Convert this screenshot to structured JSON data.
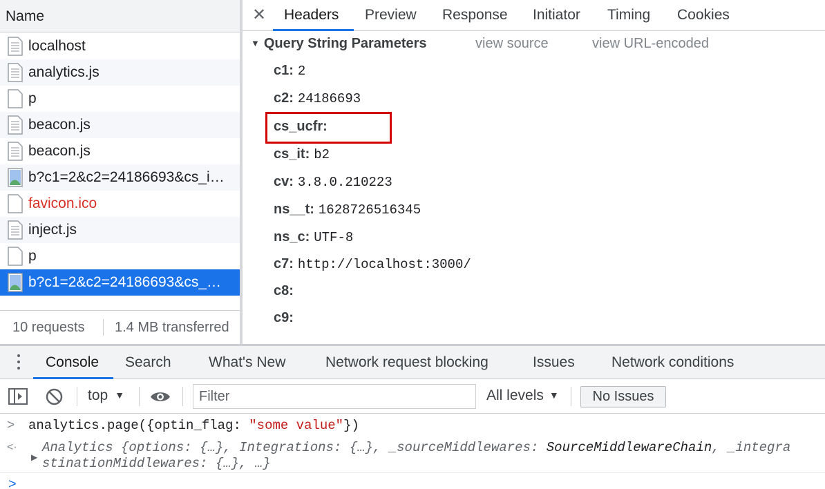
{
  "request_list": {
    "header": "Name",
    "items": [
      {
        "name": "localhost",
        "icon": "document-icon"
      },
      {
        "name": "analytics.js",
        "icon": "script-icon"
      },
      {
        "name": "p",
        "icon": "blank-file-icon"
      },
      {
        "name": "beacon.js",
        "icon": "script-icon"
      },
      {
        "name": "beacon.js",
        "icon": "script-icon"
      },
      {
        "name": "b?c1=2&c2=24186693&cs_i…",
        "icon": "image-icon"
      },
      {
        "name": "favicon.ico",
        "icon": "blank-file-icon",
        "status": "error"
      },
      {
        "name": "inject.js",
        "icon": "script-icon"
      },
      {
        "name": "p",
        "icon": "blank-file-icon"
      },
      {
        "name": "b?c1=2&c2=24186693&cs_…",
        "icon": "image-icon",
        "selected": true
      }
    ],
    "status": {
      "requests": "10 requests",
      "transferred": "1.4 MB transferred"
    }
  },
  "detail": {
    "close_icon": "✕",
    "tabs": [
      "Headers",
      "Preview",
      "Response",
      "Initiator",
      "Timing",
      "Cookies"
    ],
    "active_tab": "Headers",
    "section_title": "Query String Parameters",
    "view_source": "view source",
    "view_url_encoded": "view URL-encoded",
    "params": [
      {
        "key": "c1:",
        "value": "2"
      },
      {
        "key": "c2:",
        "value": "24186693"
      },
      {
        "key": "cs_ucfr:",
        "value": ""
      },
      {
        "key": "cs_it:",
        "value": "b2"
      },
      {
        "key": "cv:",
        "value": "3.8.0.210223"
      },
      {
        "key": "ns__t:",
        "value": "1628726516345"
      },
      {
        "key": "ns_c:",
        "value": "UTF-8"
      },
      {
        "key": "c7:",
        "value": "http://localhost:3000/"
      },
      {
        "key": "c8:",
        "value": ""
      },
      {
        "key": "c9:",
        "value": ""
      }
    ],
    "highlighted_param": "cs_ucfr:",
    "highlight_color": "#d30000"
  },
  "drawer": {
    "tabs": [
      "Console",
      "Search",
      "What's New",
      "Network request blocking",
      "Issues",
      "Network conditions"
    ],
    "active_tab": "Console",
    "toolbar": {
      "context": "top",
      "filter_placeholder": "Filter",
      "levels": "All levels",
      "no_issues": "No Issues"
    },
    "console": {
      "input_prefix": ">",
      "output_prefix": "<·",
      "cmd_pre": "analytics.page({optin_flag: ",
      "cmd_str": "\"some value\"",
      "cmd_post": "})",
      "result_line1_parts": [
        "Analytics {",
        "options",
        ": {…}, ",
        "Integrations",
        ": {…}, ",
        "_sourceMiddlewares",
        ": ",
        "SourceMiddlewareChain",
        ", ",
        "_integra"
      ],
      "result_line2_parts": [
        "stinationMiddlewares",
        ": {…}, …}"
      ],
      "prompt": ">"
    }
  },
  "colors": {
    "accent": "#1a73e8",
    "error_text": "#d93025",
    "string_literal": "#c41a16"
  }
}
